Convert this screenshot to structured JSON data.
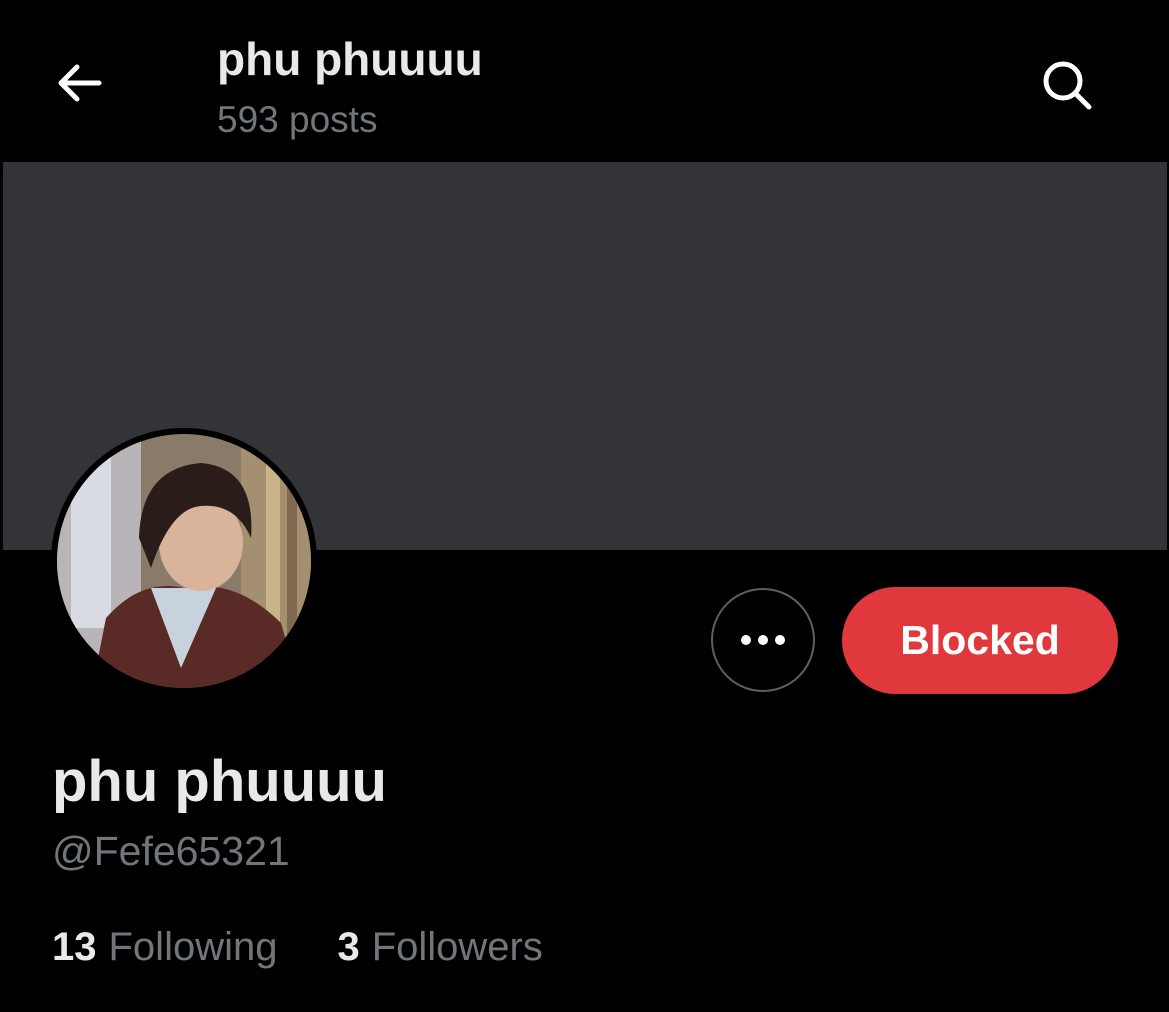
{
  "header": {
    "title": "phu phuuuu",
    "post_count": "593 posts",
    "back_icon": "arrow-left-icon",
    "search_icon": "search-icon"
  },
  "profile": {
    "display_name": "phu phuuuu",
    "handle": "@Fefe65321",
    "more_icon": "more-horizontal-icon",
    "block_button_label": "Blocked",
    "stats": [
      {
        "count": "13",
        "label": "Following"
      },
      {
        "count": "3",
        "label": "Followers"
      }
    ]
  },
  "colors": {
    "background": "#000000",
    "banner": "#333438",
    "primary_text": "#e7e9ea",
    "secondary_text": "#71767b",
    "blocked_button": "#e0383c"
  }
}
